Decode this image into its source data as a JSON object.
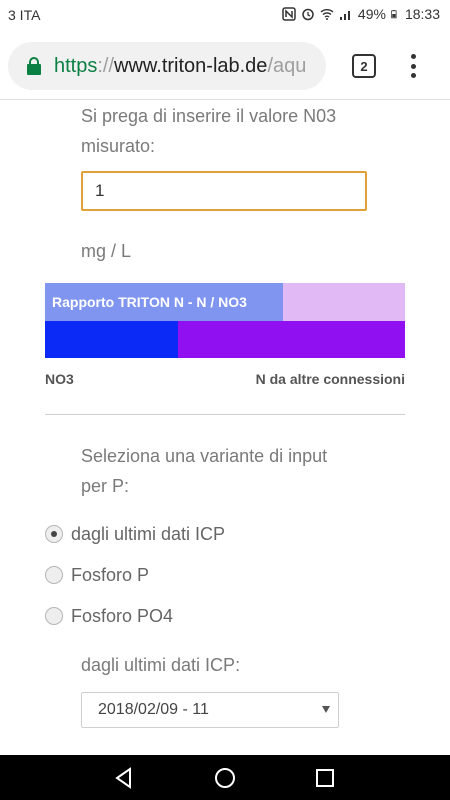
{
  "status_bar": {
    "carrier": "3 ITA",
    "battery": "49%",
    "time": "18:33"
  },
  "browser": {
    "url_scheme": "https",
    "url_sep": "://",
    "url_host": "www.triton-lab.de",
    "url_path": "/aqu",
    "tab_count": "2"
  },
  "form": {
    "no3_prompt_line1": "Si prega di inserire il valore N03",
    "no3_prompt_line2": "misurato:",
    "no3_value": "1",
    "unit": "mg / L",
    "ratio": {
      "title": "Rapporto TRITON N - N / NO3",
      "no3_label": "NO3",
      "other_label": "N da altre connessioni",
      "no3_fraction": 0.37,
      "colors": {
        "header": "#8095f0",
        "header_light": "#e0b9f5",
        "no3": "#0b2af5",
        "other": "#9010f2"
      }
    },
    "p_prompt_line1": "Seleziona una variante di input",
    "p_prompt_line2": "per P:",
    "p_options": [
      {
        "label": "dagli ultimi dati ICP",
        "checked": true
      },
      {
        "label": "Fosforo P",
        "checked": false
      },
      {
        "label": "Fosforo PO4",
        "checked": false
      }
    ],
    "icp_label": "dagli ultimi dati ICP:",
    "icp_selected": "2018/02/09 - 11"
  },
  "icons": {
    "lock": "lock-icon",
    "nfc": "nfc-icon",
    "alarm": "alarm-icon",
    "wifi": "wifi-icon",
    "signal": "signal-icon",
    "battery": "battery-icon",
    "back": "back-icon",
    "home": "home-icon",
    "recents": "recents-icon"
  }
}
